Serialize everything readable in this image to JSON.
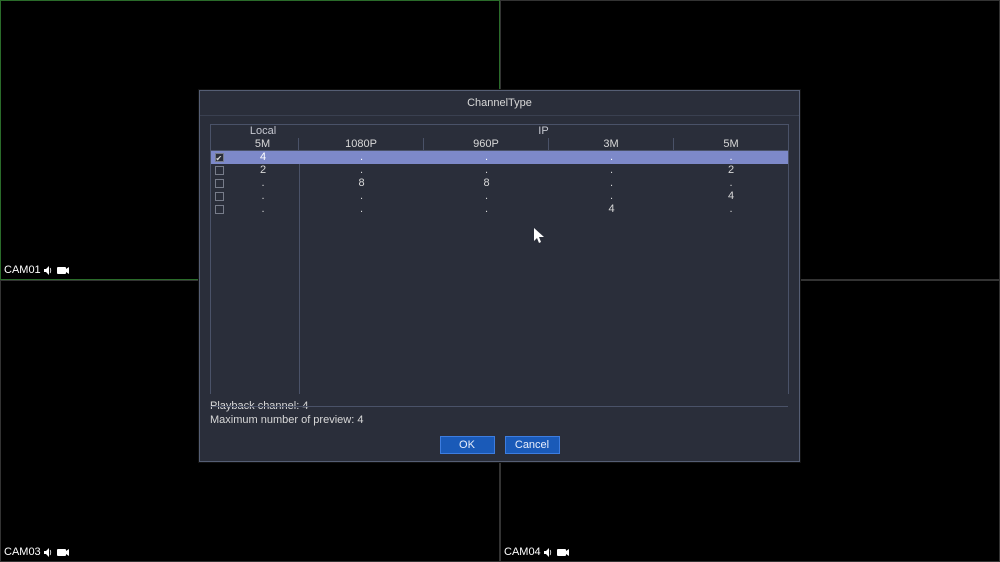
{
  "cams": {
    "cam01": "CAM01",
    "cam03": "CAM03",
    "cam04": "CAM04"
  },
  "dialog": {
    "title": "ChannelType",
    "group_local": "Local",
    "group_ip": "IP",
    "headers": {
      "h1": "5M",
      "h2": "1080P",
      "h3": "960P",
      "h4": "3M",
      "h5": "5M"
    },
    "rows": [
      {
        "checked": true,
        "c1": "4",
        "c2": ".",
        "c3": ".",
        "c4": ".",
        "c5": "."
      },
      {
        "checked": false,
        "c1": "2",
        "c2": ".",
        "c3": ".",
        "c4": ".",
        "c5": "2"
      },
      {
        "checked": false,
        "c1": ".",
        "c2": "8",
        "c3": "8",
        "c4": ".",
        "c5": "."
      },
      {
        "checked": false,
        "c1": ".",
        "c2": ".",
        "c3": ".",
        "c4": ".",
        "c5": "4"
      },
      {
        "checked": false,
        "c1": ".",
        "c2": ".",
        "c3": ".",
        "c4": "4",
        "c5": "."
      }
    ],
    "playback": "Playback channel: 4",
    "max_preview": "Maximum number of preview: 4",
    "ok_label": "OK",
    "cancel_label": "Cancel"
  }
}
